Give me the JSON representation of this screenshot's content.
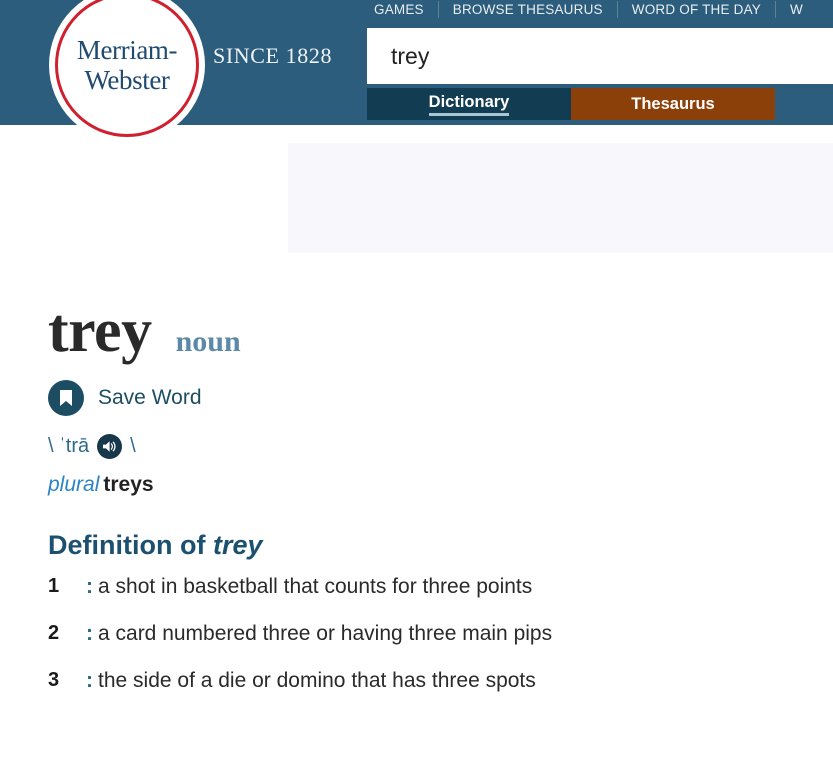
{
  "header": {
    "logo": {
      "line1": "Merriam-",
      "line2": "Webster",
      "tagline": "SINCE 1828"
    },
    "nav": [
      {
        "label": "GAMES"
      },
      {
        "label": "BROWSE THESAURUS"
      },
      {
        "label": "WORD OF THE DAY"
      },
      {
        "label": "W"
      }
    ],
    "search": {
      "value": "trey",
      "placeholder": ""
    },
    "tabs": [
      {
        "label": "Dictionary",
        "active": true
      },
      {
        "label": "Thesaurus",
        "active": false
      }
    ]
  },
  "entry": {
    "headword": "trey",
    "part_of_speech": "noun",
    "save_word_label": "Save Word",
    "save_word_icon": "bookmark-icon",
    "pronunciation_open": "\\ ˈtrā",
    "pronunciation_close": "\\",
    "audio_icon": "speaker-icon",
    "inflection_label": "plural",
    "inflection_value": "treys",
    "definition_heading_prefix": "Definition of ",
    "definition_heading_word": "trey",
    "senses": [
      {
        "number": "1",
        "colon": ":",
        "text": "a shot in basketball that counts for three points"
      },
      {
        "number": "2",
        "colon": ":",
        "text": "a card numbered three or having three main pips"
      },
      {
        "number": "3",
        "colon": ":",
        "text": "the side of a die or domino that has three spots"
      }
    ]
  },
  "colors": {
    "header_bg": "#2d5d7c",
    "tab_active_bg": "#123c52",
    "tab_thesaurus_bg": "#8a4008",
    "logo_ring": "#cf202f",
    "logo_text": "#1f4b73",
    "accent_teal": "#1c4d63",
    "link_blue": "#2d6a8c",
    "ad_bg": "#f7f7fc"
  }
}
